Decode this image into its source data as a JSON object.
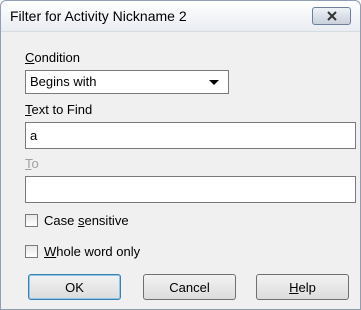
{
  "window": {
    "title": "Filter for Activity Nickname 2",
    "close_icon": "close-icon"
  },
  "condition": {
    "label_mnemonic": "C",
    "label_rest": "ondition",
    "selected": "Begins with"
  },
  "text_to_find": {
    "label_mnemonic": "T",
    "label_rest": "ext to Find",
    "value": "a"
  },
  "to": {
    "label_mnemonic": "T",
    "label_rest": "o",
    "value": ""
  },
  "options": {
    "case_sensitive": {
      "label_before": "Case ",
      "label_mnemonic": "s",
      "label_after": "ensitive",
      "checked": false
    },
    "whole_word": {
      "label_before": "",
      "label_mnemonic": "W",
      "label_after": "hole word only",
      "checked": false
    }
  },
  "buttons": {
    "ok": "OK",
    "cancel": "Cancel",
    "help_mnemonic": "H",
    "help_rest": "elp"
  }
}
